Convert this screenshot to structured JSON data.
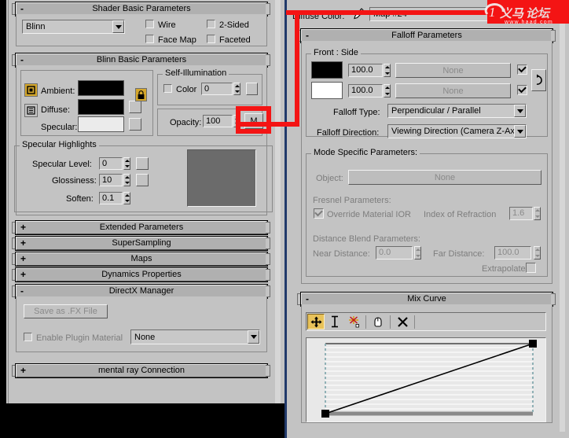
{
  "left_panel": {
    "rollouts": {
      "shader_basic": {
        "title": "Shader Basic Parameters",
        "state": "-",
        "shader_value": "Blinn",
        "checks": [
          {
            "label": "Wire",
            "checked": false
          },
          {
            "label": "2-Sided",
            "checked": false
          },
          {
            "label": "Face Map",
            "checked": false
          },
          {
            "label": "Faceted",
            "checked": false
          }
        ]
      },
      "blinn_basic": {
        "title": "Blinn Basic Parameters",
        "state": "-",
        "colors": [
          {
            "label": "Ambient:",
            "swatch": "#000000"
          },
          {
            "label": "Diffuse:",
            "swatch": "#000000"
          },
          {
            "label": "Specular:",
            "swatch": "#ebebeb"
          }
        ],
        "self_illumination": {
          "title": "Self-Illumination",
          "color_label": "Color",
          "color_checked": false,
          "value": "0"
        },
        "opacity": {
          "label": "Opacity:",
          "value": "100",
          "map_button": "M"
        },
        "specular_highlights": {
          "title": "Specular Highlights",
          "rows": [
            {
              "label": "Specular Level:",
              "value": "0"
            },
            {
              "label": "Glossiness:",
              "value": "10"
            },
            {
              "label": "Soften:",
              "value": "0.1"
            }
          ],
          "preview_color": "#6b6b6b"
        }
      },
      "collapsed": [
        {
          "title": "Extended Parameters",
          "state": "+"
        },
        {
          "title": "SuperSampling",
          "state": "+"
        },
        {
          "title": "Maps",
          "state": "+"
        },
        {
          "title": "Dynamics Properties",
          "state": "+"
        }
      ],
      "directx": {
        "title": "DirectX Manager",
        "state": "-",
        "save_fx_button": "Save as .FX File",
        "enable_plugin_label": "Enable Plugin Material",
        "enable_plugin_checked": false,
        "plugin_value": "None"
      },
      "mental_ray": {
        "title": "mental ray Connection",
        "state": "+"
      }
    }
  },
  "right_panel": {
    "header": {
      "slot_label": "Diffuse Color:",
      "map_name": "Map #24"
    },
    "falloff": {
      "title": "Falloff Parameters",
      "state": "-",
      "front_side": {
        "title": "Front : Side",
        "rows": [
          {
            "swatch": "#000000",
            "amount": "100.0",
            "map": "None",
            "checked": true
          },
          {
            "swatch": "#ffffff",
            "amount": "100.0",
            "map": "None",
            "checked": true
          }
        ],
        "falloff_type_label": "Falloff Type:",
        "falloff_type_value": "Perpendicular / Parallel",
        "falloff_direction_label": "Falloff Direction:",
        "falloff_direction_value": "Viewing Direction (Camera Z-Axis)"
      },
      "mode_specific": {
        "title": "Mode Specific Parameters:",
        "object_label": "Object:",
        "object_value": "None",
        "fresnel_title": "Fresnel Parameters:",
        "override_ior_label": "Override Material IOR",
        "override_ior_checked": true,
        "ior_label": "Index of Refraction",
        "ior_value": "1.6",
        "distance_title": "Distance Blend Parameters:",
        "near_label": "Near Distance:",
        "near_value": "0.0",
        "far_label": "Far Distance:",
        "far_value": "100.0",
        "extrapolate_label": "Extrapolate",
        "extrapolate_checked": false
      }
    },
    "mix_curve": {
      "title": "Mix Curve",
      "state": "-",
      "tools": [
        {
          "name": "move-keys-tool",
          "selected": true
        },
        {
          "name": "scale-keys-tool",
          "selected": false
        },
        {
          "name": "add-point-tool",
          "selected": false
        },
        {
          "name": "pan-tool",
          "selected": false
        },
        {
          "name": "delete-point-tool",
          "selected": false
        }
      ],
      "axis_top": "1",
      "axis_bottom": "0"
    }
  },
  "annotation": {
    "color": "#f41414"
  },
  "watermark": {
    "text": "haad",
    "url": "www.haad.com"
  }
}
